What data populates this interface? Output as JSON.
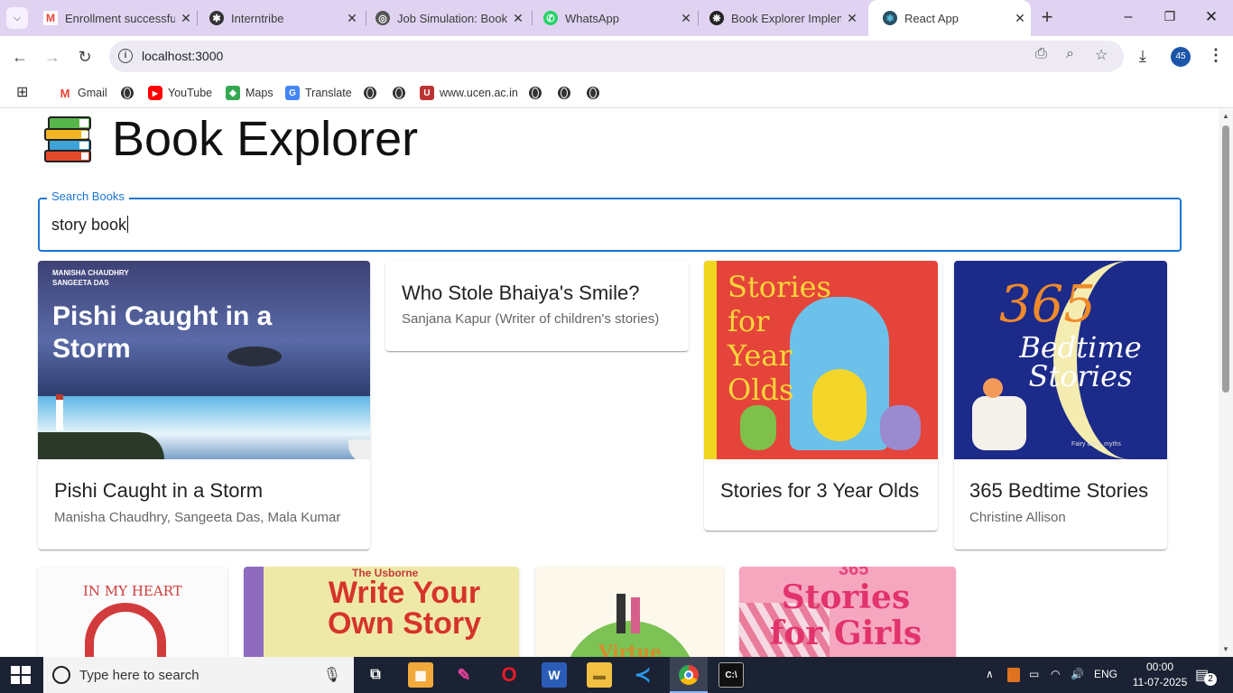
{
  "browser": {
    "tabs": [
      {
        "title": "Enrollment successful",
        "favicon": "gmail-icon"
      },
      {
        "title": "Interntribe",
        "favicon": "interntribe-icon"
      },
      {
        "title": "Job Simulation: Book",
        "favicon": "globe-icon"
      },
      {
        "title": "WhatsApp",
        "favicon": "whatsapp-icon"
      },
      {
        "title": "Book Explorer Implem",
        "favicon": "chatgpt-icon"
      },
      {
        "title": "React App",
        "favicon": "react-icon"
      }
    ],
    "url": "localhost:3000",
    "profile": "45",
    "bookmarks": [
      {
        "label": "Gmail"
      },
      {
        "label": "YouTube"
      },
      {
        "label": "Maps"
      },
      {
        "label": "Translate"
      },
      {
        "label": "www.ucen.ac.in"
      }
    ]
  },
  "app": {
    "title": "Book Explorer",
    "search": {
      "label": "Search Books",
      "value": "story book"
    },
    "books_row1": [
      {
        "title": "Pishi Caught in a Storm",
        "authors": "Manisha Chaudhry, Sangeeta Das, Mala Kumar",
        "cover_text": "Pishi Caught in a Storm",
        "cover_authors": "MANISHA CHAUDHRY SANGEETA DAS"
      },
      {
        "title": "Who Stole Bhaiya's Smile?",
        "authors": "Sanjana Kapur (Writer of children's stories)"
      },
      {
        "title": "Stories for 3 Year Olds",
        "authors": "",
        "cover_text": "Stories for Year Olds",
        "cover_num": "3"
      },
      {
        "title": "365 Bedtime Stories",
        "authors": "Christine Allison",
        "cover_num": "365",
        "cover_text": "Bedtime Stories",
        "cover_sub": "Fairy tales, myths"
      }
    ],
    "books_row2_covers": [
      {
        "cover_text": "IN MY HEART"
      },
      {
        "cover_text": "Write Your Own Story",
        "cover_top": "The Usborne"
      },
      {
        "cover_text": "Virtue"
      },
      {
        "cover_text": "Stories for Girls",
        "cover_top": "365"
      }
    ]
  },
  "taskbar": {
    "search_placeholder": "Type here to search",
    "lang": "ENG",
    "time": "00:00",
    "date": "11-07-2025",
    "notifications": "2",
    "chrome_badge": "45"
  }
}
